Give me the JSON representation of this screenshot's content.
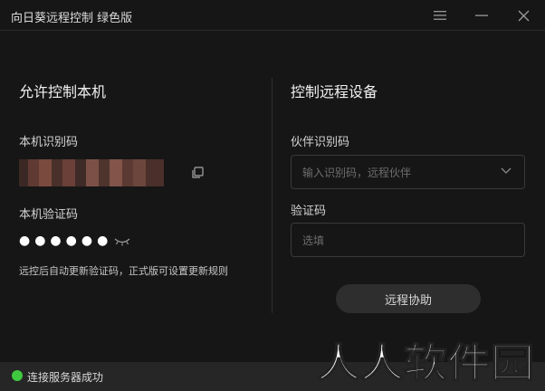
{
  "window": {
    "title": "向日葵远程控制 绿色版"
  },
  "titlebar_buttons": {
    "menu_icon": "hamburger-icon",
    "minimize_icon": "minimize-icon",
    "close_icon": "close-icon"
  },
  "left": {
    "title": "允许控制本机",
    "id_label": "本机识别码",
    "code_label": "本机验证码",
    "code_value": "●●●●●●",
    "note": "远控后自动更新验证码，正式版可设置更新规则"
  },
  "right": {
    "title": "控制远程设备",
    "partner_label": "伙伴识别码",
    "partner_placeholder": "输入识别码，远程伙伴",
    "verify_label": "验证码",
    "verify_placeholder": "选填",
    "remote_button": "远程协助"
  },
  "status": {
    "text": "连接服务器成功",
    "color": "#3fc93f"
  },
  "watermark": {
    "text": "人人软件园"
  },
  "colors": {
    "background": "#161616",
    "statusbar": "#262626",
    "button": "#2e2e2e"
  }
}
